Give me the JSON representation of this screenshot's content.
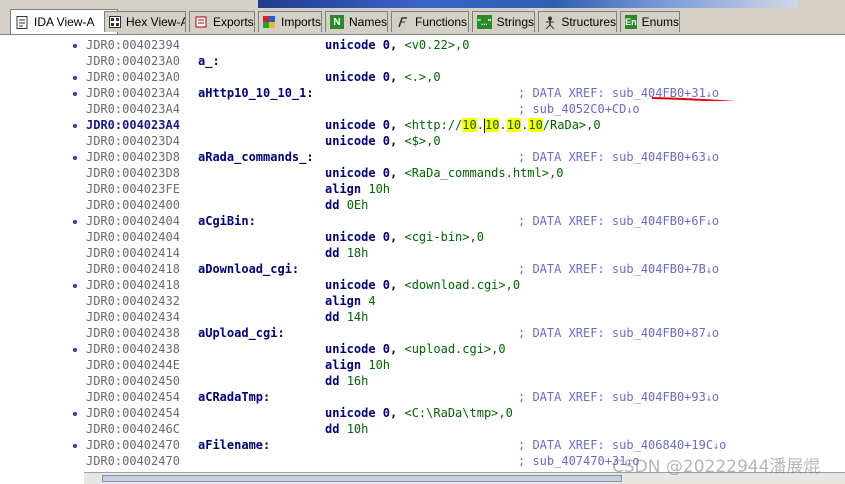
{
  "tabs": [
    {
      "label": "IDA View-A",
      "icon": "document-icon",
      "active": true
    },
    {
      "label": "Hex View-A",
      "icon": "hex-icon",
      "active": false
    },
    {
      "label": "Exports",
      "icon": "exports-icon",
      "active": false
    },
    {
      "label": "Imports",
      "icon": "imports-icon",
      "active": false
    },
    {
      "label": "Names",
      "icon": "names-icon",
      "active": false
    },
    {
      "label": "Functions",
      "icon": "functions-icon",
      "active": false
    },
    {
      "label": "Strings",
      "icon": "strings-icon",
      "active": false
    },
    {
      "label": "Structures",
      "icon": "structures-icon",
      "active": false
    },
    {
      "label": "Enums",
      "icon": "enums-icon",
      "active": false
    }
  ],
  "tab_icons_text": {
    "names": "N",
    "strings": "\"...\"",
    "enums": "En"
  },
  "lines": [
    {
      "addr": "JDR0:00402394",
      "label": "",
      "instr": "unicode 0, ",
      "operand": "<v0.22>,0",
      "comment": ""
    },
    {
      "addr": "JDR0:004023A0",
      "label": "a_:",
      "instr": "",
      "operand": "",
      "comment": ""
    },
    {
      "addr": "JDR0:004023A0",
      "label": "",
      "instr": "unicode 0, ",
      "operand": "<.>,0",
      "comment": ""
    },
    {
      "addr": "JDR0:004023A4",
      "label": "aHttp10_10_10_1:",
      "instr": "",
      "operand": "",
      "comment": "; DATA XREF: sub_404FB0+31"
    },
    {
      "addr": "JDR0:004023A4",
      "label": "",
      "instr": "",
      "operand": "",
      "comment": "; sub_4052C0+CD"
    },
    {
      "addr": "JDR0:004023A4",
      "label": "",
      "instr": "unicode 0, ",
      "operand": "",
      "comment": ""
    },
    {
      "addr": "JDR0:004023D4",
      "label": "",
      "instr": "unicode 0, ",
      "operand": "<$>,0",
      "comment": ""
    },
    {
      "addr": "JDR0:004023D8",
      "label": "aRada_commands_:",
      "instr": "",
      "operand": "",
      "comment": "; DATA XREF: sub_404FB0+63"
    },
    {
      "addr": "JDR0:004023D8",
      "label": "",
      "instr": "unicode 0, ",
      "operand": "<RaDa_commands.html>,0",
      "comment": ""
    },
    {
      "addr": "JDR0:004023FE",
      "label": "",
      "instr": "align ",
      "operand": "10h",
      "comment": ""
    },
    {
      "addr": "JDR0:00402400",
      "label": "",
      "instr": "dd ",
      "operand": "0Eh",
      "comment": ""
    },
    {
      "addr": "JDR0:00402404",
      "label": "aCgiBin:",
      "instr": "",
      "operand": "",
      "comment": "; DATA XREF: sub_404FB0+6F"
    },
    {
      "addr": "JDR0:00402404",
      "label": "",
      "instr": "unicode 0, ",
      "operand": "<cgi-bin>,0",
      "comment": ""
    },
    {
      "addr": "JDR0:00402414",
      "label": "",
      "instr": "dd ",
      "operand": "18h",
      "comment": ""
    },
    {
      "addr": "JDR0:00402418",
      "label": "aDownload_cgi:",
      "instr": "",
      "operand": "",
      "comment": "; DATA XREF: sub_404FB0+7B"
    },
    {
      "addr": "JDR0:00402418",
      "label": "",
      "instr": "unicode 0, ",
      "operand": "<download.cgi>,0",
      "comment": ""
    },
    {
      "addr": "JDR0:00402432",
      "label": "",
      "instr": "align ",
      "operand": "4",
      "comment": ""
    },
    {
      "addr": "JDR0:00402434",
      "label": "",
      "instr": "dd ",
      "operand": "14h",
      "comment": ""
    },
    {
      "addr": "JDR0:00402438",
      "label": "aUpload_cgi:",
      "instr": "",
      "operand": "",
      "comment": "; DATA XREF: sub_404FB0+87"
    },
    {
      "addr": "JDR0:00402438",
      "label": "",
      "instr": "unicode 0, ",
      "operand": "<upload.cgi>,0",
      "comment": ""
    },
    {
      "addr": "JDR0:0040244E",
      "label": "",
      "instr": "align ",
      "operand": "10h",
      "comment": ""
    },
    {
      "addr": "JDR0:00402450",
      "label": "",
      "instr": "dd ",
      "operand": "16h",
      "comment": ""
    },
    {
      "addr": "JDR0:00402454",
      "label": "aCRadaTmp:",
      "instr": "",
      "operand": "",
      "comment": "; DATA XREF: sub_404FB0+93"
    },
    {
      "addr": "JDR0:00402454",
      "label": "",
      "instr": "unicode 0, ",
      "operand": "<C:\\RaDa\\tmp>,0",
      "comment": ""
    },
    {
      "addr": "JDR0:0040246C",
      "label": "",
      "instr": "dd ",
      "operand": "10h",
      "comment": ""
    },
    {
      "addr": "JDR0:00402470",
      "label": "aFilename:",
      "instr": "",
      "operand": "",
      "comment": "; DATA XREF: sub_406840+19C"
    },
    {
      "addr": "JDR0:00402470",
      "label": "",
      "instr": "",
      "operand": "",
      "comment": "; sub_407470+31"
    }
  ],
  "url_line": {
    "prefix": "<http://",
    "octet1": "10",
    "dot1": ".",
    "octet2": "10",
    "dot2": ".",
    "octet3": "10",
    "dot3": ".",
    "octet4": "10",
    "suffix": "/RaDa>,0"
  },
  "xref_suffix": "o",
  "watermark": "CSDN @20222944潘展焜",
  "colors": {
    "address": "#6b6b6b",
    "label": "#000080",
    "operand": "#006400",
    "comment": "#6a6ad0",
    "highlight": "#ffff00",
    "annotation": "#e00000"
  }
}
